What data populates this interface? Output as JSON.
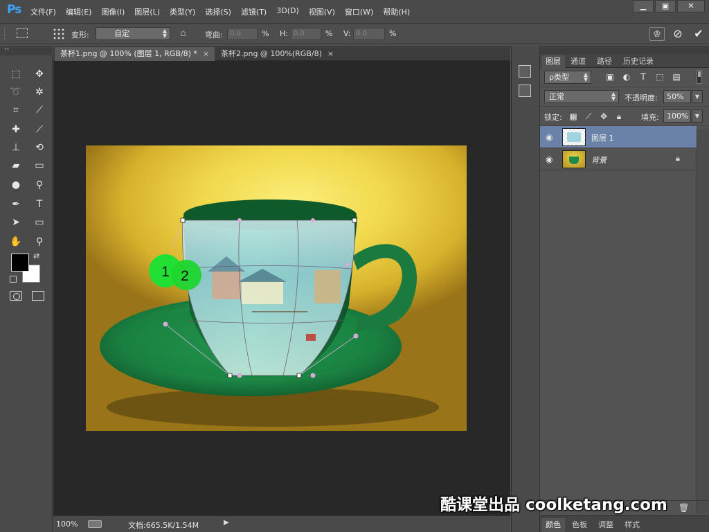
{
  "app": {
    "logo": "Ps"
  },
  "menu": [
    "文件(F)",
    "编辑(E)",
    "图像(I)",
    "图层(L)",
    "类型(Y)",
    "选择(S)",
    "滤镜(T)",
    "3D(D)",
    "视图(V)",
    "窗口(W)",
    "帮助(H)"
  ],
  "window_controls": {
    "minimize": "▁",
    "maximize": "▣",
    "close": "✕"
  },
  "options": {
    "transform_label": "变形:",
    "transform_value": "自定",
    "bend_label": "弯曲:",
    "bend_value": "0.0",
    "h_label": "H:",
    "h_value": "0.0",
    "v_label": "V:",
    "v_value": "0.0",
    "percent": "%"
  },
  "tabs": [
    {
      "label": "茶杯1.png @ 100% (图层 1, RGB/8) *",
      "close": "×"
    },
    {
      "label": "茶杯2.png @ 100%(RGB/8)",
      "close": "×"
    }
  ],
  "callouts": [
    "1",
    "2"
  ],
  "status": {
    "zoom": "100%",
    "doc": "文档:665.5K/1.54M",
    "arrow": "▶"
  },
  "layers_panel": {
    "tabs": [
      "图层",
      "通道",
      "路径",
      "历史记录"
    ],
    "filter_kind": "ρ类型",
    "blend_mode": "正常",
    "opacity_label": "不透明度:",
    "opacity_value": "50%",
    "lock_label": "锁定:",
    "fill_label": "填充:",
    "fill_value": "100%",
    "layers": [
      {
        "name": "图层 1",
        "selected": true
      },
      {
        "name": "背景",
        "locked": true
      }
    ]
  },
  "bottom_tabs": [
    "颜色",
    "色板",
    "调整",
    "样式"
  ],
  "watermark": "酷课堂出品 coolketang.com",
  "colors": {
    "saucer": "#1f8c48",
    "cup": "#1b7a3e",
    "overlay": "#a9e0e8",
    "callout": "#22e033",
    "selected_layer": "#6a82a8"
  }
}
